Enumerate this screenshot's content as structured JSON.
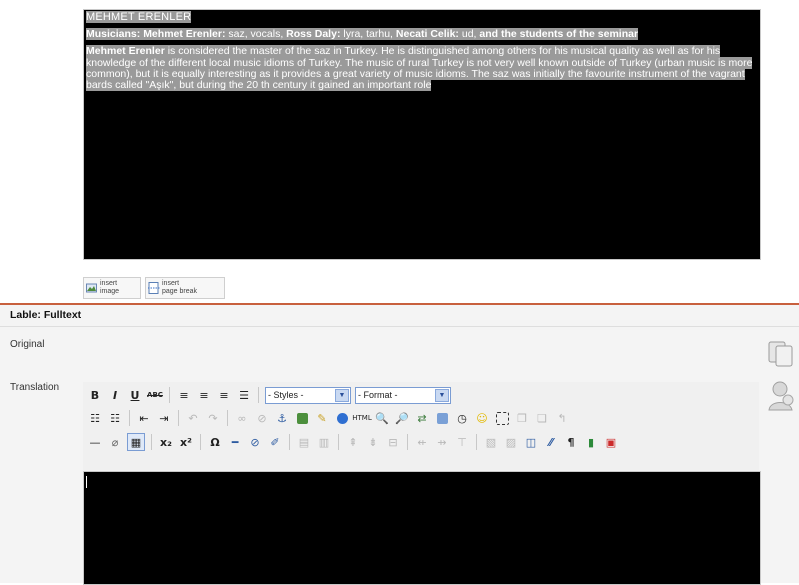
{
  "upper_editor": {
    "title": "MEHMET ERENLER",
    "musicians": [
      {
        "text": "Musicians:",
        "bold": true
      },
      {
        "text": " ",
        "bold": false
      },
      {
        "text": "Mehmet Erenler:",
        "bold": true
      },
      {
        "text": " saz, vocals, ",
        "bold": false
      },
      {
        "text": "Ross Daly:",
        "bold": true
      },
      {
        "text": " lyra, tarhu, ",
        "bold": false
      },
      {
        "text": "Necati Celik:",
        "bold": true
      },
      {
        "text": " ud, ",
        "bold": false
      },
      {
        "text": "and the students of the seminar",
        "bold": true
      }
    ],
    "body_name": "Mehmet Erenler",
    "body_text": " is considered the master of the saz in Turkey. He is distinguished among others for his musical quality as well as for his knowledge of the different local music idioms of Turkey. The music of rural Turkey is not very well known outside of Turkey (urban music is more common), but it is equally interesting as it provides a great variety of music idioms. The saz was initially the favourite instrument of the vagrant bards called \"Aşık\", but during the 20 th century it gained an important role"
  },
  "insert_buttons": {
    "image": {
      "line1": "insert",
      "line2": "image"
    },
    "page_break": {
      "line1": "insert",
      "line2": "page break"
    }
  },
  "section": {
    "title": "Lable: Fulltext",
    "original_label": "Original",
    "translation_label": "Translation"
  },
  "toolbar": {
    "styles_select": "- Styles -",
    "format_select": "- Format -",
    "row1": [
      "B",
      "I",
      "U",
      "ABC"
    ],
    "row3": [
      "—",
      "x₂",
      "x²",
      "Ω",
      "¶"
    ]
  },
  "colors": {
    "accent_divider": "#c8603e",
    "editor_bg": "#000000",
    "highlight": "#9a9a9a",
    "select_border": "#7a9cd3"
  }
}
